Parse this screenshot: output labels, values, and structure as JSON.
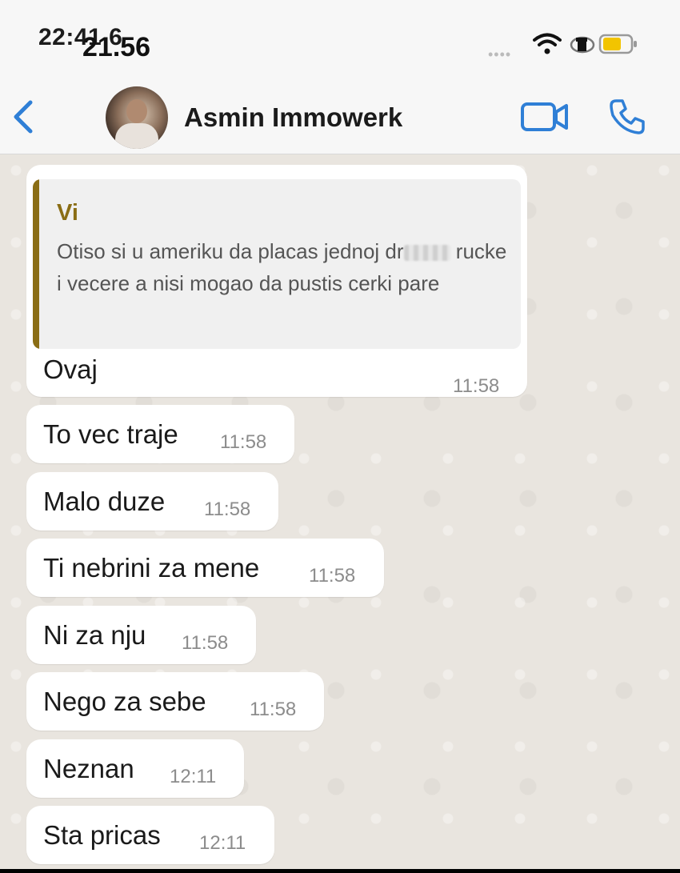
{
  "status": {
    "time_behind": "22:41 6",
    "time_front": "21.56",
    "signal": "••••"
  },
  "header": {
    "contact_name": "Asmin Immowerk"
  },
  "quoted": {
    "author": "Vi",
    "text": "Otiso si u ameriku da placas jednoj dr",
    "text_rest": "rucke i vecere a nisi mogao da pustis cerki pare"
  },
  "messages": [
    {
      "text": "Ovaj",
      "time": "11:58"
    },
    {
      "text": "To vec traje",
      "time": "11:58"
    },
    {
      "text": "Malo duze",
      "time": "11:58"
    },
    {
      "text": "Ti nebrini za mene",
      "time": "11:58"
    },
    {
      "text": "Ni za nju",
      "time": "11:58"
    },
    {
      "text": "Nego za sebe",
      "time": "11:58"
    },
    {
      "text": "Neznan",
      "time": "12:11"
    },
    {
      "text": "Sta pricas",
      "time": "12:11"
    }
  ],
  "colors": {
    "accent": "#2f7fd6",
    "quote_author": "#8a6d14",
    "chat_bg": "#e9e5df"
  },
  "icons": [
    "back-chevron-icon",
    "video-call-icon",
    "phone-call-icon",
    "wifi-icon",
    "battery-icon"
  ]
}
